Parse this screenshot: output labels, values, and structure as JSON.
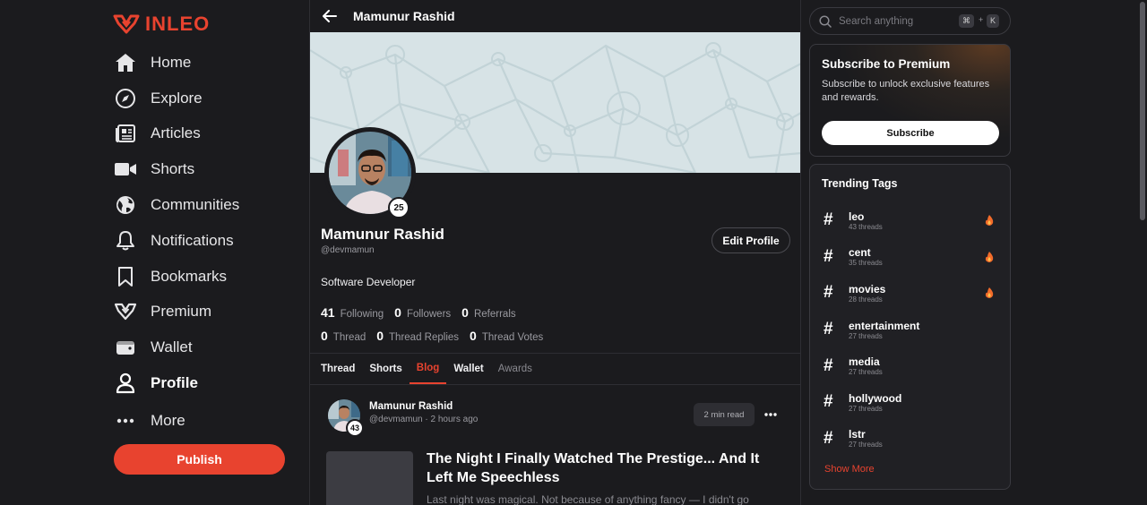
{
  "app": {
    "logo_text": "INLEO",
    "brand_color": "#e8432f"
  },
  "sidebar": {
    "items": [
      {
        "label": "Home",
        "icon": "home-icon"
      },
      {
        "label": "Explore",
        "icon": "compass-icon"
      },
      {
        "label": "Articles",
        "icon": "newspaper-icon"
      },
      {
        "label": "Shorts",
        "icon": "video-icon"
      },
      {
        "label": "Communities",
        "icon": "globe-icon"
      },
      {
        "label": "Notifications",
        "icon": "bell-icon"
      },
      {
        "label": "Bookmarks",
        "icon": "bookmark-icon"
      },
      {
        "label": "Premium",
        "icon": "premium-icon"
      },
      {
        "label": "Wallet",
        "icon": "wallet-icon"
      },
      {
        "label": "Profile",
        "icon": "user-icon"
      },
      {
        "label": "More",
        "icon": "more-icon"
      }
    ],
    "active": "Profile",
    "publish_label": "Publish"
  },
  "header": {
    "title": "Mamunur Rashid"
  },
  "profile": {
    "name": "Mamunur Rashid",
    "handle": "@devmamun",
    "level": "25",
    "bio": "Software Developer",
    "edit_label": "Edit Profile",
    "stats_row1": [
      {
        "num": "41",
        "label": "Following"
      },
      {
        "num": "0",
        "label": "Followers"
      },
      {
        "num": "0",
        "label": "Referrals"
      }
    ],
    "stats_row2": [
      {
        "num": "0",
        "label": "Thread"
      },
      {
        "num": "0",
        "label": "Thread Replies"
      },
      {
        "num": "0",
        "label": "Thread Votes"
      }
    ]
  },
  "tabs": [
    {
      "label": "Thread",
      "state": "normal"
    },
    {
      "label": "Shorts",
      "state": "normal"
    },
    {
      "label": "Blog",
      "state": "active"
    },
    {
      "label": "Wallet",
      "state": "normal"
    },
    {
      "label": "Awards",
      "state": "muted"
    }
  ],
  "post": {
    "author": "Mamunur Rashid",
    "level": "43",
    "handle": "@devmamun",
    "separator": "·",
    "time": "2 hours ago",
    "read_time": "2 min read",
    "title": "The Night I Finally Watched The Prestige... And It Left Me Speechless",
    "excerpt": "Last night was magical. Not because of anything fancy — I didn't go"
  },
  "search": {
    "placeholder": "Search anything",
    "key1": "⌘",
    "plus": "+",
    "key2": "K"
  },
  "premium": {
    "title": "Subscribe to Premium",
    "text": "Subscribe to unlock exclusive features and rewards.",
    "button": "Subscribe"
  },
  "trending": {
    "title": "Trending Tags",
    "tags": [
      {
        "name": "leo",
        "count": "43 threads",
        "hot": true
      },
      {
        "name": "cent",
        "count": "35 threads",
        "hot": true
      },
      {
        "name": "movies",
        "count": "28 threads",
        "hot": true
      },
      {
        "name": "entertainment",
        "count": "27 threads",
        "hot": false
      },
      {
        "name": "media",
        "count": "27 threads",
        "hot": false
      },
      {
        "name": "hollywood",
        "count": "27 threads",
        "hot": false
      },
      {
        "name": "lstr",
        "count": "27 threads",
        "hot": false
      }
    ],
    "show_more": "Show More"
  }
}
